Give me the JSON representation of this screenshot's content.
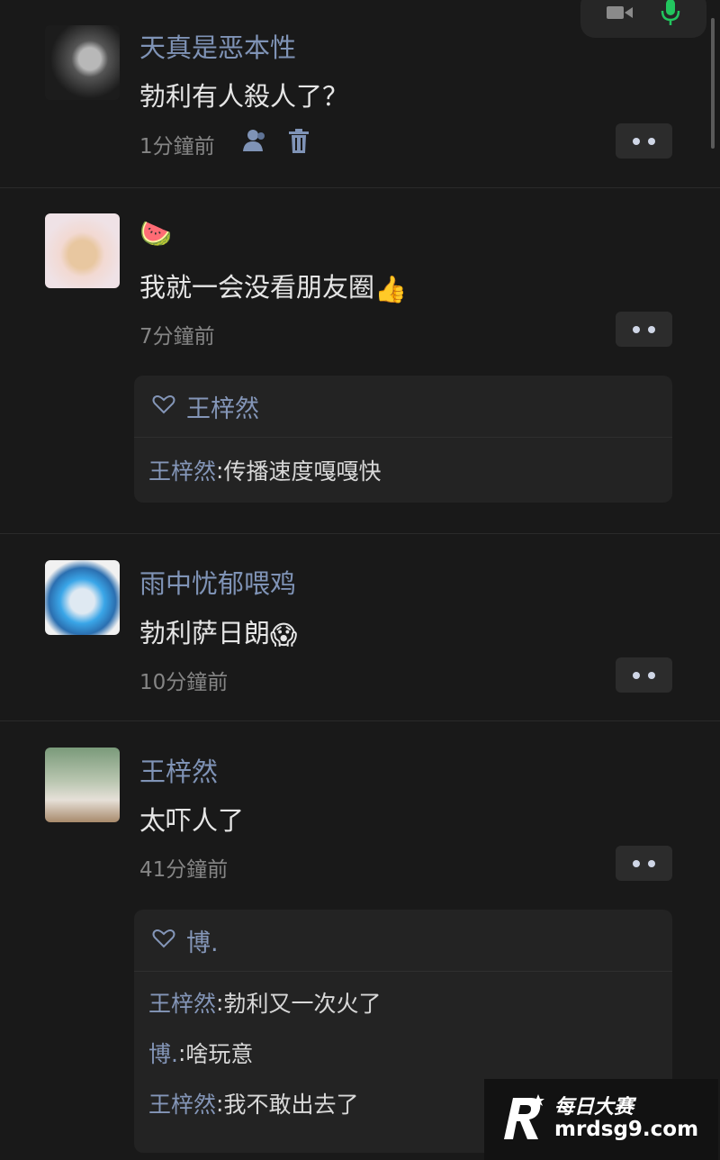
{
  "posts": [
    {
      "name": "天真是恶本性",
      "content": "勃利有人殺人了？",
      "time": "1分鐘前",
      "avatar": "avatar-dark-photo",
      "actions": [
        "contacts-icon",
        "trash-icon"
      ]
    },
    {
      "name": "🍉",
      "content": "我就一会没看朋友圈",
      "content_emoji": "👍",
      "time": "7分鐘前",
      "avatar": "avatar-teddy-bear",
      "likes": [
        "王梓然"
      ],
      "comments": [
        {
          "name": "王梓然",
          "sep": ": ",
          "text": "传播速度嘎嘎快"
        }
      ]
    },
    {
      "name": "雨中忧郁喂鸡",
      "content": "勃利萨日朗",
      "content_emoji": "😱",
      "time": "10分鐘前",
      "avatar": "avatar-blue-cartoon"
    },
    {
      "name": "王梓然",
      "content": "太吓人了",
      "time": "41分鐘前",
      "avatar": "avatar-girl-dog",
      "likes": [
        "博."
      ],
      "comments": [
        {
          "name": "王梓然",
          "sep": ": ",
          "text": "勃利又一次火了"
        },
        {
          "name": "博.",
          "sep": ": ",
          "text": "啥玩意"
        },
        {
          "name": "王梓然",
          "sep": ": ",
          "text": "我不敢出去了"
        }
      ]
    }
  ],
  "call_overlay": {
    "icons": [
      "video-icon",
      "mic-icon"
    ],
    "accent": "#22c55e"
  },
  "watermark": {
    "line1": "每日大赛",
    "line2": "mrdsg9.com"
  },
  "colors": {
    "name": "#7f93b6",
    "background": "#191919"
  }
}
